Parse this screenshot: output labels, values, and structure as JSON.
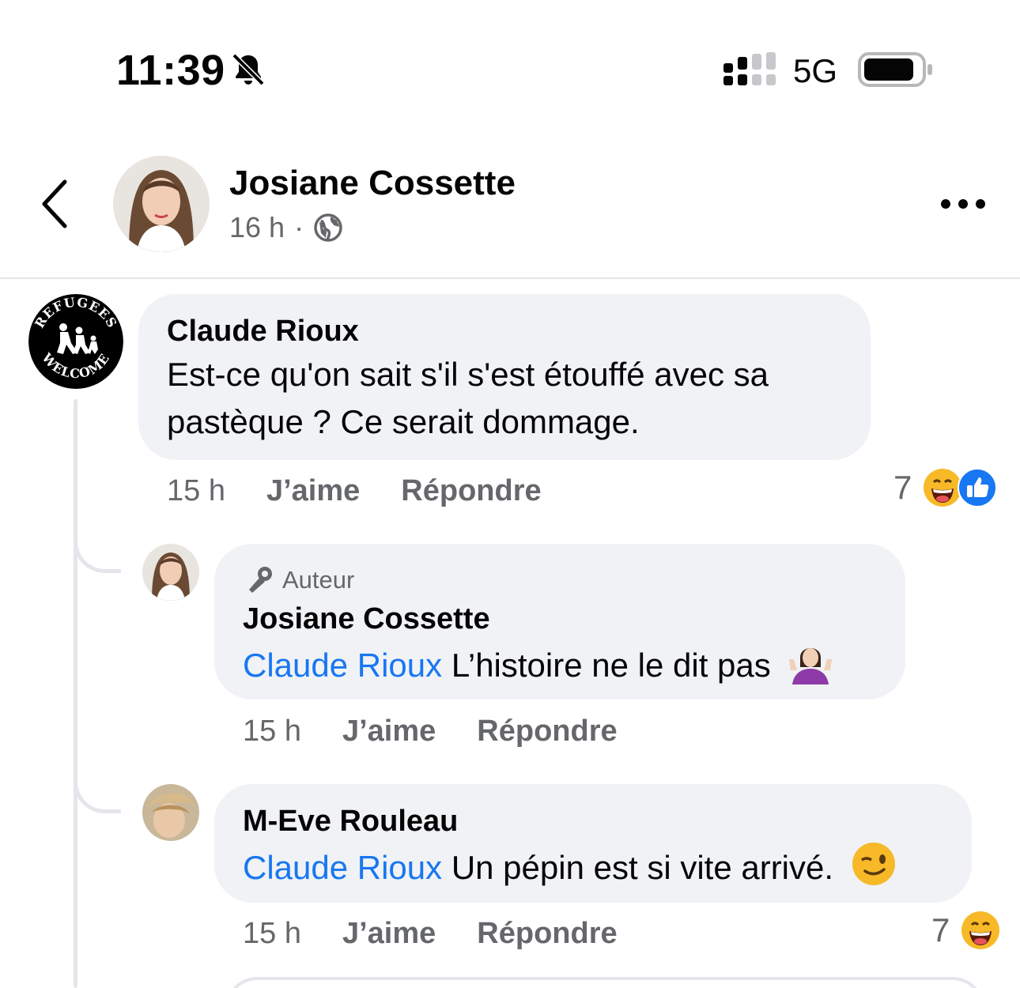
{
  "status_bar": {
    "time": "11:39",
    "network": "5G",
    "bell_icon": "bell-slash-icon",
    "signal_icon": "cellular-signal-icon",
    "battery_icon": "battery-icon"
  },
  "header": {
    "name": "Josiane Cossette",
    "age": "16 h",
    "separator": "·",
    "privacy_icon": "globe-icon",
    "more_icon": "more-dots-icon",
    "back_icon": "chevron-left-icon"
  },
  "comments": [
    {
      "author": "Claude Rioux",
      "text_line1": "Est-ce qu'on sait s'il s'est étouffé avec sa",
      "text_line2": "pastèque ? Ce serait dommage.",
      "time": "15 h",
      "like": "J’aime",
      "reply": "Répondre",
      "reaction_count": "7",
      "reaction_icons": [
        "laughing-face-icon",
        "like-thumb-icon"
      ]
    },
    {
      "badge": "Auteur",
      "badge_icon": "microphone-icon",
      "author": "Josiane Cossette",
      "mention": "Claude Rioux",
      "text": "L’histoire ne le dit pas",
      "emoji": "shrug-emoji-icon",
      "time": "15 h",
      "like": "J’aime",
      "reply": "Répondre"
    },
    {
      "author": "M-Eve Rouleau",
      "mention": "Claude Rioux",
      "text": "Un pépin est si vite arrivé.",
      "emoji": "winking-face-icon",
      "time": "15 h",
      "like": "J’aime",
      "reply": "Répondre",
      "reaction_count": "7",
      "reaction_icons": [
        "laughing-face-icon"
      ]
    }
  ],
  "refugees_logo": {
    "top_text": "REFUGEES",
    "bottom_text": "WELCOME"
  },
  "colors": {
    "mention": "#1877f2",
    "bubble": "#f0f2f5",
    "secondary_text": "#65676b",
    "like_blue": "#1877f2"
  }
}
